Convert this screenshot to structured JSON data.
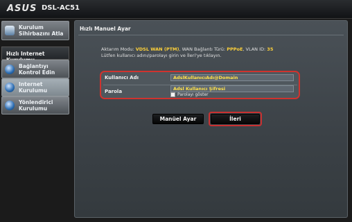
{
  "header": {
    "brand": "ASUS",
    "model": "DSL-AC51"
  },
  "sidebar": {
    "wizard_item": "Kurulum Sihirbazını Atla",
    "section_title": "Hızlı Internet Kurulumu",
    "items": [
      {
        "label": "Bağlantıyı Kontrol Edin"
      },
      {
        "label": "Internet Kurulumu"
      },
      {
        "label": "Yönlendirici Kurulumu"
      }
    ]
  },
  "main": {
    "title": "Hızlı Manuel Ayar",
    "info": {
      "prefix": "Aktarım Modu: ",
      "mode": "VDSL WAN (PTM)",
      "wan_text": ", WAN Bağlantı Türü: ",
      "wan_type": "PPPoE",
      "vlan_text": ", VLAN ID: ",
      "vlan_id": "35",
      "line2": "Lütfen kullanıcı adını/parolayı girin ve İleri'ye tıklayın."
    },
    "form": {
      "username_label": "Kullanıcı Adı",
      "username_value": "AdslKullanıcıAdı@Domain",
      "password_label": "Parola",
      "password_value": "Adsl Kullanıcı Şifresi",
      "show_password": "Parolayı göster"
    },
    "buttons": {
      "manual": "Manüel Ayar",
      "next": "İleri"
    }
  },
  "colors": {
    "highlight": "#ffd23a",
    "outline": "#d0332e"
  }
}
